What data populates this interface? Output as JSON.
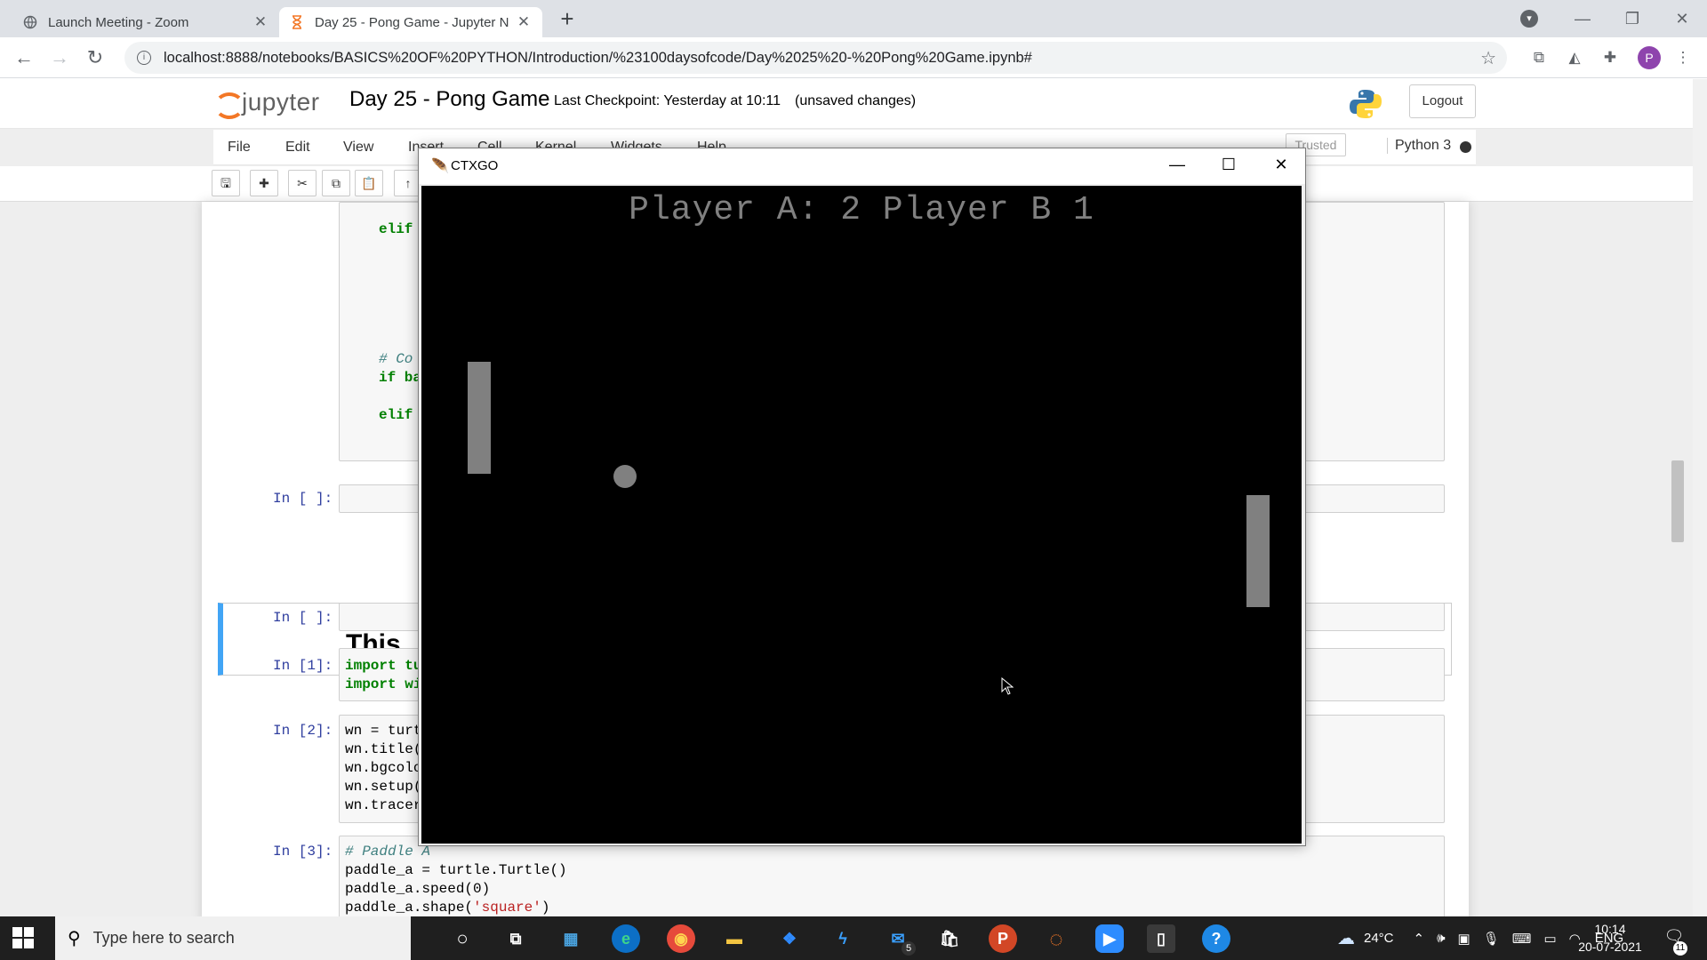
{
  "browser": {
    "tabs": [
      {
        "title": "Launch Meeting - Zoom",
        "active": false
      },
      {
        "title": "Day 25 - Pong Game - Jupyter N",
        "active": true
      }
    ],
    "url": "localhost:8888/notebooks/BASICS%20OF%20PYTHON/Introduction/%23100daysofcode/Day%2025%20-%20Pong%20Game.ipynb#",
    "profile_initial": "P"
  },
  "jupyter": {
    "logo_text": "jupyter",
    "notebook_title": "Day 25 - Pong Game",
    "checkpoint": "Last Checkpoint: Yesterday at 10:11",
    "unsaved": "(unsaved changes)",
    "logout_label": "Logout",
    "menu": [
      "File",
      "Edit",
      "View",
      "Insert",
      "Cell",
      "Kernel",
      "Widgets",
      "Help"
    ],
    "trusted_label": "Trusted",
    "kernel_label": "Python 3"
  },
  "cells": {
    "partial_code": [
      "elif",
      "# Co",
      "if ba",
      "elif"
    ],
    "empty_prompt": "In [ ]:",
    "markdown_heading": "This",
    "cell1": {
      "prompt": "In [1]:",
      "lines": [
        "import tu",
        "import wi"
      ]
    },
    "cell2": {
      "prompt": "In [2]:",
      "lines": [
        "wn = turt",
        "wn.title(",
        "wn.bgcolo",
        "wn.setup(",
        "wn.tracer"
      ]
    },
    "cell3": {
      "prompt": "In [3]:",
      "comment": "# Paddle A",
      "line1": "paddle_a = turtle.Turtle()",
      "line2": "paddle_a.speed(0)",
      "line3_pre": "paddle_a.shape(",
      "line3_str": "'square'",
      "line3_post": ")"
    }
  },
  "game_window": {
    "title": "CTXGO",
    "score_text": "Player A: 2 Player B 1",
    "bg_color": "#000000",
    "object_color": "#808080"
  },
  "taskbar": {
    "search_placeholder": "Type here to search",
    "weather": "24°C",
    "language": "ENG",
    "time": "10:14",
    "date": "20-07-2021",
    "mail_badge": "5",
    "notif_badge": "11"
  }
}
